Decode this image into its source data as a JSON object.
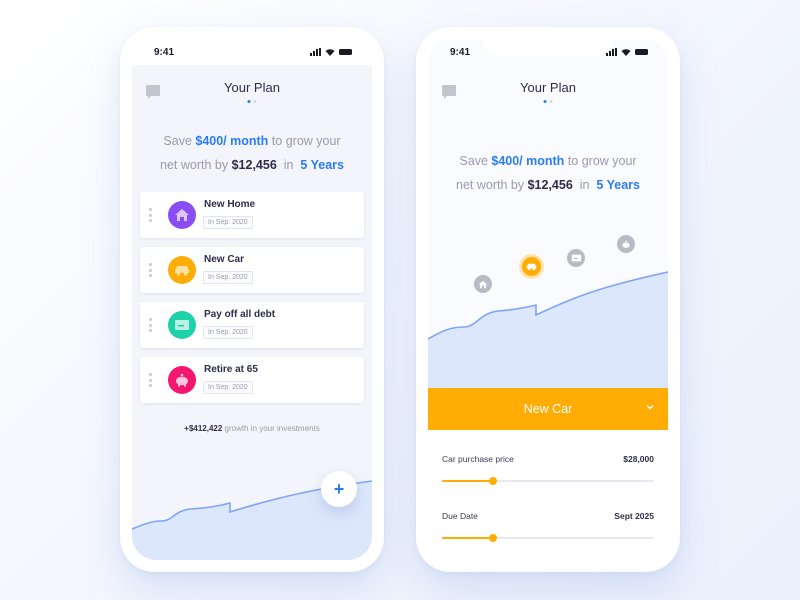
{
  "status_bar": {
    "time": "9:41"
  },
  "colors": {
    "accent_blue": "#2a7cf5",
    "accent_orange": "#ffac05",
    "home_purple": "#8a4cf3",
    "car_orange": "#ffac05",
    "debt_teal": "#1fd1a8",
    "retire_pink": "#f5176f",
    "chart_line": "#7ea4f5",
    "chart_fill": "#dde7fb"
  },
  "screens": [
    {
      "header": {
        "title": "Your Plan",
        "chat_icon": "chat-bubble-icon",
        "page_index": 0,
        "page_count": 2
      },
      "headline": {
        "p1": "Save ",
        "amount": "$400/",
        "period": " month",
        "p2": " to grow your",
        "p3": "net worth by ",
        "net_worth": "$12,456",
        "p4": "  in  ",
        "years": "5 Years"
      },
      "goals": [
        {
          "title": "New Home",
          "date": "In Sep. 2020",
          "icon": "house-icon"
        },
        {
          "title": "New Car",
          "date": "In Sep. 2020",
          "icon": "car-icon"
        },
        {
          "title": "Pay off all debt",
          "date": "In Sep. 2020",
          "icon": "credit-card-icon"
        },
        {
          "title": "Retire at 65",
          "date": "In Sep. 2020",
          "icon": "piggy-bank-icon"
        }
      ],
      "growth": {
        "amount": "+$412,422",
        "text": " growth in your investments"
      },
      "fab_label": "+"
    },
    {
      "header": {
        "title": "Your Plan",
        "chat_icon": "chat-bubble-icon",
        "page_index": 0,
        "page_count": 2
      },
      "headline": {
        "p1": "Save ",
        "amount": "$400/",
        "period": " month",
        "p2": " to grow your",
        "p3": "net worth by ",
        "net_worth": "$12,456",
        "p4": "  in  ",
        "years": "5 Years"
      },
      "milestones": [
        {
          "name": "New Home",
          "icon": "house-icon",
          "active": false
        },
        {
          "name": "New Car",
          "icon": "car-icon",
          "active": true
        },
        {
          "name": "Pay off all debt",
          "icon": "credit-card-icon",
          "active": false
        },
        {
          "name": "Retire at 65",
          "icon": "piggy-bank-icon",
          "active": false
        }
      ],
      "selected_goal": "New Car",
      "fields": [
        {
          "label": "Car purchase price",
          "value": "$28,000",
          "slider_fraction": 0.24
        },
        {
          "label": "Due Date",
          "value": "Sept 2025",
          "slider_fraction": 0.24
        }
      ]
    }
  ]
}
